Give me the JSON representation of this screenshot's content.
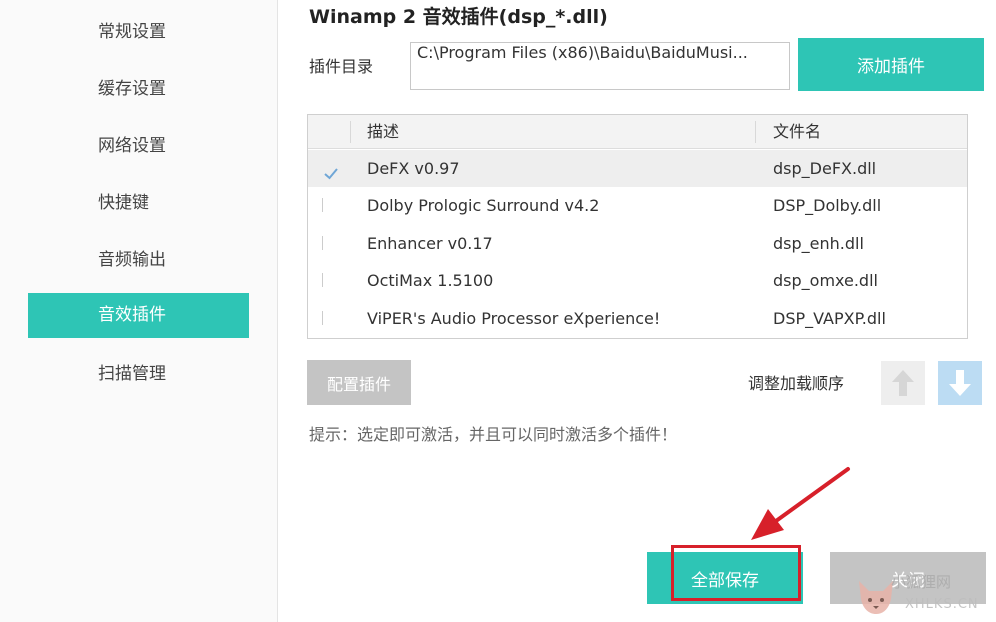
{
  "sidebar": {
    "items": [
      {
        "label": "常规设置"
      },
      {
        "label": "缓存设置"
      },
      {
        "label": "网络设置"
      },
      {
        "label": "快捷键"
      },
      {
        "label": "音频输出"
      },
      {
        "label": "音效插件",
        "active": true
      },
      {
        "label": "扫描管理"
      }
    ]
  },
  "main": {
    "title": "Winamp 2 音效插件(dsp_*.dll)",
    "plugin_dir_label": "插件目录",
    "plugin_dir_value": "C:\\Program Files (x86)\\Baidu\\BaiduMusi...",
    "add_plugin_label": "添加插件",
    "table": {
      "headers": {
        "desc": "描述",
        "file": "文件名"
      },
      "rows": [
        {
          "desc": "DeFX v0.97",
          "file": "dsp_DeFX.dll",
          "checked": true,
          "selected": true
        },
        {
          "desc": "Dolby Prologic Surround v4.2",
          "file": "DSP_Dolby.dll",
          "checked": false
        },
        {
          "desc": "Enhancer v0.17",
          "file": "dsp_enh.dll",
          "checked": false
        },
        {
          "desc": "OctiMax 1.5100",
          "file": "dsp_omxe.dll",
          "checked": false
        },
        {
          "desc": "ViPER's Audio Processor eXperience!",
          "file": "DSP_VAPXP.dll",
          "checked": false
        }
      ]
    },
    "config_plugin_label": "配置插件",
    "order_label": "调整加载顺序",
    "tip": "提示：选定即可激活，并且可以同时激活多个插件！",
    "save_all_label": "全部保存",
    "close_label": "关闭"
  },
  "watermark": {
    "line1": "小狐狸网",
    "line2": "XHLKS.CN"
  },
  "colors": {
    "accent": "#2ec5b5",
    "disabled": "#c4c4c4",
    "highlight": "#d7202a",
    "arrow_down_bg": "#bcdcf3",
    "icons": [
      "arrow-up-icon",
      "arrow-down-icon",
      "checkmark-icon",
      "annotation-arrow-icon",
      "fox-logo-icon"
    ]
  }
}
